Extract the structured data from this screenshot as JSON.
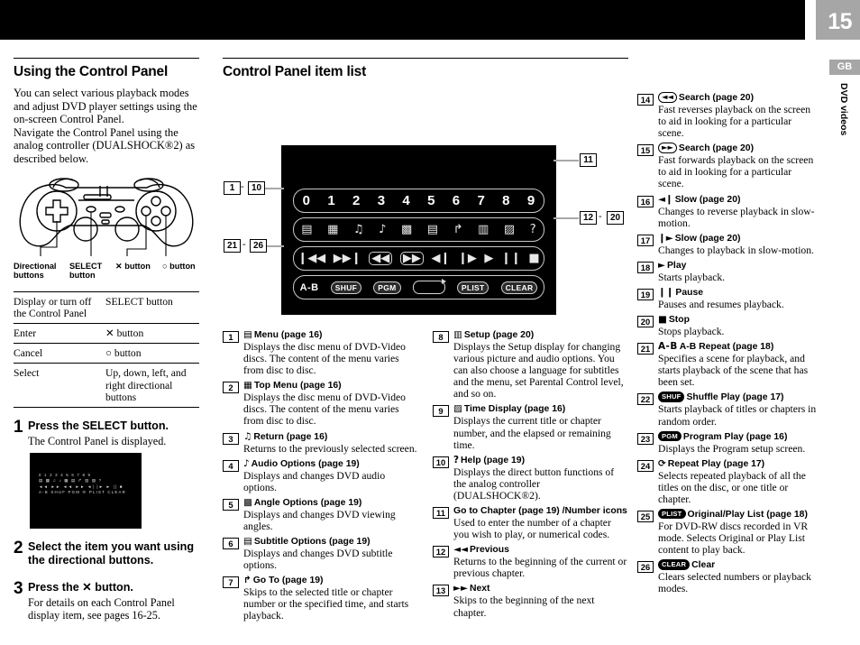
{
  "page": {
    "number": "15",
    "language_badge": "GB",
    "side_tab": "DVD videos"
  },
  "left": {
    "heading": "Using the Control Panel",
    "intro1": "You can select various playback modes and adjust DVD player settings using the on-screen Control Panel.",
    "intro2": "Navigate the Control Panel using the analog controller (DUALSHOCK®2) as described below.",
    "controller_labels": {
      "directional": "Directional buttons",
      "select": "SELECT button",
      "cross": "✕ button",
      "circle": "○ button"
    },
    "ops_table": [
      {
        "action": "Display or turn off the Control Panel",
        "button": "SELECT button"
      },
      {
        "action": "Enter",
        "button": "✕ button"
      },
      {
        "action": "Cancel",
        "button": "○ button"
      },
      {
        "action": "Select",
        "button": "Up, down, left, and right directional buttons"
      }
    ],
    "steps": [
      {
        "n": "1",
        "head": "Press the SELECT button.",
        "text": "The Control Panel is displayed.",
        "screen_rows": [
          "0 1 2 3 4 5 6 7 8 9",
          "▤ ▦ ♫ ♪ ▩ ▤ ↱ ▥ ▨ ?",
          "◄◄ ►► ◄◄ ►► ◄| |► ► || ■",
          "A-B SHUF PGM ⟳ PLIST CLEAR"
        ]
      },
      {
        "n": "2",
        "head": "Select the item you want using the directional buttons.",
        "text": ""
      },
      {
        "n": "3",
        "head": "Press the ✕ button.",
        "text": "For details on each Control Panel display item, see pages 16-25."
      }
    ]
  },
  "middle": {
    "heading": "Control Panel item list",
    "osd": {
      "numbers": [
        "0",
        "1",
        "2",
        "3",
        "4",
        "5",
        "6",
        "7",
        "8",
        "9"
      ],
      "functions": [
        "menu-icon",
        "top-menu-icon",
        "return-icon",
        "audio-icon",
        "angle-icon",
        "subtitle-icon",
        "goto-icon",
        "setup-icon",
        "time-display-icon",
        "help-icon"
      ],
      "transport": [
        "previous",
        "next",
        "scan-reverse",
        "scan-forward",
        "slow-reverse",
        "slow-forward",
        "play",
        "pause",
        "stop"
      ],
      "modes": [
        "A-B",
        "SHUF",
        "PGM",
        "repeat-loop",
        "PLIST",
        "CLEAR"
      ]
    },
    "callouts": {
      "left_top_from": "1",
      "left_top_to": "10",
      "left_bottom_from": "21",
      "left_bottom_to": "26",
      "right_top": "11",
      "right_mid_from": "12",
      "right_mid_to": "20",
      "dash": "-"
    },
    "items": [
      {
        "n": "1",
        "glyph": "▤",
        "title": "Menu (page 16)",
        "desc": "Displays the disc menu of DVD-Video discs. The content of the menu varies from disc to disc."
      },
      {
        "n": "2",
        "glyph": "▦",
        "title": "Top Menu (page 16)",
        "desc": "Displays the disc menu of DVD-Video discs. The content of the menu varies from disc to disc."
      },
      {
        "n": "3",
        "glyph": "♫",
        "title": "Return (page 16)",
        "desc": "Returns to the previously selected screen."
      },
      {
        "n": "4",
        "glyph": "♪",
        "title": "Audio Options (page 19)",
        "desc": "Displays and changes DVD audio options."
      },
      {
        "n": "5",
        "glyph": "▩",
        "title": "Angle Options (page 19)",
        "desc": "Displays and changes DVD viewing angles."
      },
      {
        "n": "6",
        "glyph": "▤",
        "title": "Subtitle Options (page 19)",
        "desc": "Displays and changes DVD subtitle options."
      },
      {
        "n": "7",
        "glyph": "↱",
        "title": "Go To (page 19)",
        "desc": "Skips to the selected title or chapter number or the specified time, and starts playback."
      },
      {
        "n": "8",
        "glyph": "▥",
        "title": "Setup (page 20)",
        "desc": "Displays the Setup display for changing various picture and audio options. You can also choose a language for subtitles and the menu, set Parental Control level, and so on."
      },
      {
        "n": "9",
        "glyph": "▨",
        "title": "Time Display (page 16)",
        "desc": "Displays the current title or chapter number, and the elapsed or remaining time."
      },
      {
        "n": "10",
        "glyph": "?",
        "title": "Help (page 19)",
        "desc": "Displays the direct button functions of the analog controller (DUALSHOCK®2)."
      },
      {
        "n": "11",
        "glyph": "",
        "title": "Go to Chapter (page 19) /Number icons",
        "desc": "Used to enter the number of a chapter you wish to play, or numerical codes."
      },
      {
        "n": "12",
        "glyph": "◄◄",
        "title": "Previous",
        "desc": "Returns to the beginning of the current or previous chapter."
      },
      {
        "n": "13",
        "glyph": "►►",
        "title": "Next",
        "desc": "Skips to the beginning of the next chapter."
      }
    ]
  },
  "right": {
    "items": [
      {
        "n": "14",
        "chip_open": "◄◄",
        "title": "Search (page 20)",
        "desc": "Fast reverses playback on the screen to aid in looking for a particular scene."
      },
      {
        "n": "15",
        "chip_open": "►►",
        "title": "Search (page 20)",
        "desc": "Fast forwards playback on the screen to aid in looking for a particular scene."
      },
      {
        "n": "16",
        "glyph": "◄❙",
        "title": "Slow (page 20)",
        "desc": "Changes to reverse playback in slow-motion."
      },
      {
        "n": "17",
        "glyph": "❙►",
        "title": "Slow (page 20)",
        "desc": "Changes to playback in slow-motion."
      },
      {
        "n": "18",
        "glyph": "►",
        "title": "Play",
        "desc": "Starts playback."
      },
      {
        "n": "19",
        "glyph": "❙❙",
        "title": "Pause",
        "desc": "Pauses and resumes playback."
      },
      {
        "n": "20",
        "glyph": "■",
        "title": "Stop",
        "desc": "Stops playback."
      },
      {
        "n": "21",
        "glyph": "A-B",
        "title": "A-B Repeat (page 18)",
        "desc": "Specifies a scene for playback, and starts playback of the scene that has been set."
      },
      {
        "n": "22",
        "chip": "SHUF",
        "title": "Shuffle Play (page 17)",
        "desc": "Starts playback of titles or chapters in random order."
      },
      {
        "n": "23",
        "chip": "PGM",
        "title": "Program Play (page 16)",
        "desc": "Displays the Program setup screen."
      },
      {
        "n": "24",
        "glyph": "⟳",
        "title": "Repeat Play (page 17)",
        "desc": "Selects repeated playback of all the titles on the disc, or one title or chapter."
      },
      {
        "n": "25",
        "chip": "PLIST",
        "title": "Original/Play List (page 18)",
        "desc": "For DVD-RW discs recorded in VR mode. Selects Original or Play List content to play back."
      },
      {
        "n": "26",
        "chip": "CLEAR",
        "title": "Clear",
        "desc": "Clears selected numbers or playback modes."
      }
    ]
  }
}
